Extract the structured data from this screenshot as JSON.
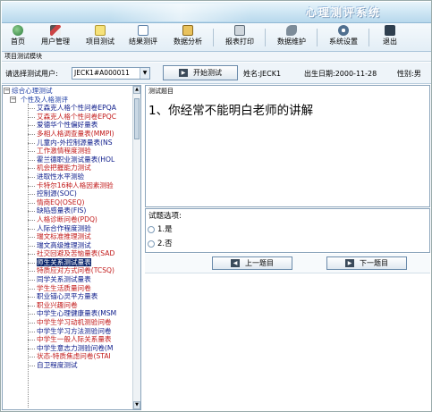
{
  "app": {
    "title": "心理测评系统"
  },
  "toolbar": [
    {
      "label": "首页",
      "icon": "home-globe-icon"
    },
    {
      "label": "用户管理",
      "icon": "user-pen-icon"
    },
    {
      "label": "项目测试",
      "icon": "test-note-icon"
    },
    {
      "label": "结果测评",
      "icon": "result-doc-icon"
    },
    {
      "label": "数据分析",
      "icon": "analysis-book-icon"
    },
    {
      "label": "报表打印",
      "icon": "print-icon"
    },
    {
      "label": "数据维护",
      "icon": "maintenance-tool-icon"
    },
    {
      "label": "系统设置",
      "icon": "settings-gear-icon"
    },
    {
      "label": "退出",
      "icon": "exit-icon"
    }
  ],
  "module": {
    "label": "项目测试模块"
  },
  "user_row": {
    "select_label": "请选择测试用户:",
    "selected_user": "JECK1#A000011",
    "start_button": "开始测试",
    "name_text": "姓名:JECK1",
    "birth_text": "出生日期:2000-11-28",
    "gender_text": "性别:男"
  },
  "tree": {
    "root": "综合心理测试",
    "group": "个性及人格测评",
    "items": [
      {
        "label": "艾森克人格个性问卷EPQA",
        "color": "blue"
      },
      {
        "label": "艾森克人格个性问卷EPQC",
        "color": "red"
      },
      {
        "label": "爱德华个性偏好量表",
        "color": "blue"
      },
      {
        "label": "多相人格调查量表(MMPI)",
        "color": "red"
      },
      {
        "label": "儿童内-外控制源量表(NS",
        "color": "blue"
      },
      {
        "label": "工作激情程度测验",
        "color": "red"
      },
      {
        "label": "霍兰德职业测试量表(HOL",
        "color": "blue"
      },
      {
        "label": "机会把握能力测试",
        "color": "red"
      },
      {
        "label": "进取性水平测验",
        "color": "blue"
      },
      {
        "label": "卡特尔16种人格因素测验",
        "color": "red"
      },
      {
        "label": "控制源(SOC)",
        "color": "blue"
      },
      {
        "label": "情商EQ(OSEQ)",
        "color": "red"
      },
      {
        "label": "缺陷感量表(FIS)",
        "color": "blue"
      },
      {
        "label": "人格诊断问卷(PDQ)",
        "color": "red"
      },
      {
        "label": "人际合作程度测验",
        "color": "blue"
      },
      {
        "label": "瑞文标准推理测试",
        "color": "red"
      },
      {
        "label": "瑞文高级推理测试",
        "color": "blue"
      },
      {
        "label": "社交回避及苦恼量表(SAD",
        "color": "red"
      },
      {
        "label": "师生关系测试量表",
        "color": "blue",
        "selected": true
      },
      {
        "label": "特质应对方式问卷(TCSQ)",
        "color": "red"
      },
      {
        "label": "同学关系测试量表",
        "color": "blue"
      },
      {
        "label": "学生生活质量问卷",
        "color": "red"
      },
      {
        "label": "职业锚心灵平方量表",
        "color": "blue"
      },
      {
        "label": "职业兴趣问卷",
        "color": "red"
      },
      {
        "label": "中学生心理健康量表(MSM",
        "color": "blue"
      },
      {
        "label": "中学生学习动机测验问卷",
        "color": "red"
      },
      {
        "label": "中学生学习方法测验问卷",
        "color": "blue"
      },
      {
        "label": "中学生一般人际关系量表",
        "color": "red"
      },
      {
        "label": "中学生意志力测验问卷(M",
        "color": "blue"
      },
      {
        "label": "状态-特质焦虑问卷(STAI",
        "color": "red"
      },
      {
        "label": "自卫程度测试",
        "color": "blue"
      }
    ]
  },
  "question": {
    "caption": "测试题目",
    "text": "1、你经常不能明白老师的讲解"
  },
  "options": {
    "caption": "试题选项:",
    "items": [
      {
        "label": "1.是"
      },
      {
        "label": "2.否"
      }
    ]
  },
  "nav": {
    "prev": "上一题目",
    "next": "下一题目"
  },
  "colors": {
    "tree_blue": "#0b1a8a",
    "tree_red": "#c11818",
    "selection": "#0a246a",
    "banner": "#c9e3f2"
  }
}
